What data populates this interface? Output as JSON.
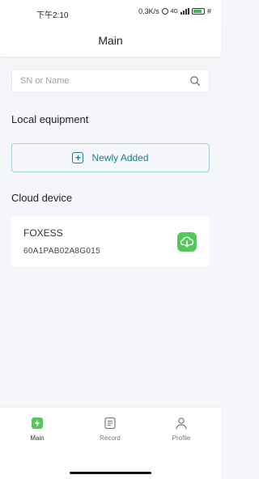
{
  "status_bar": {
    "time": "下午2:10",
    "speed": "0.3K/s",
    "network": "4G",
    "battery": "#"
  },
  "header": {
    "title": "Main"
  },
  "search": {
    "placeholder": "SN or Name"
  },
  "local": {
    "title": "Local equipment",
    "add_label": "Newly Added"
  },
  "cloud": {
    "title": "Cloud device",
    "devices": [
      {
        "name": "FOXESS",
        "sn": "60A1PAB02A8G015"
      }
    ]
  },
  "nav": {
    "items": [
      {
        "label": "Main",
        "icon": "bolt-icon"
      },
      {
        "label": "Record",
        "icon": "document-icon"
      },
      {
        "label": "Profile",
        "icon": "person-icon"
      }
    ]
  },
  "colors": {
    "accent": "#1d7f8c",
    "brand_green": "#58c75a",
    "background": "#f4f6f9"
  }
}
